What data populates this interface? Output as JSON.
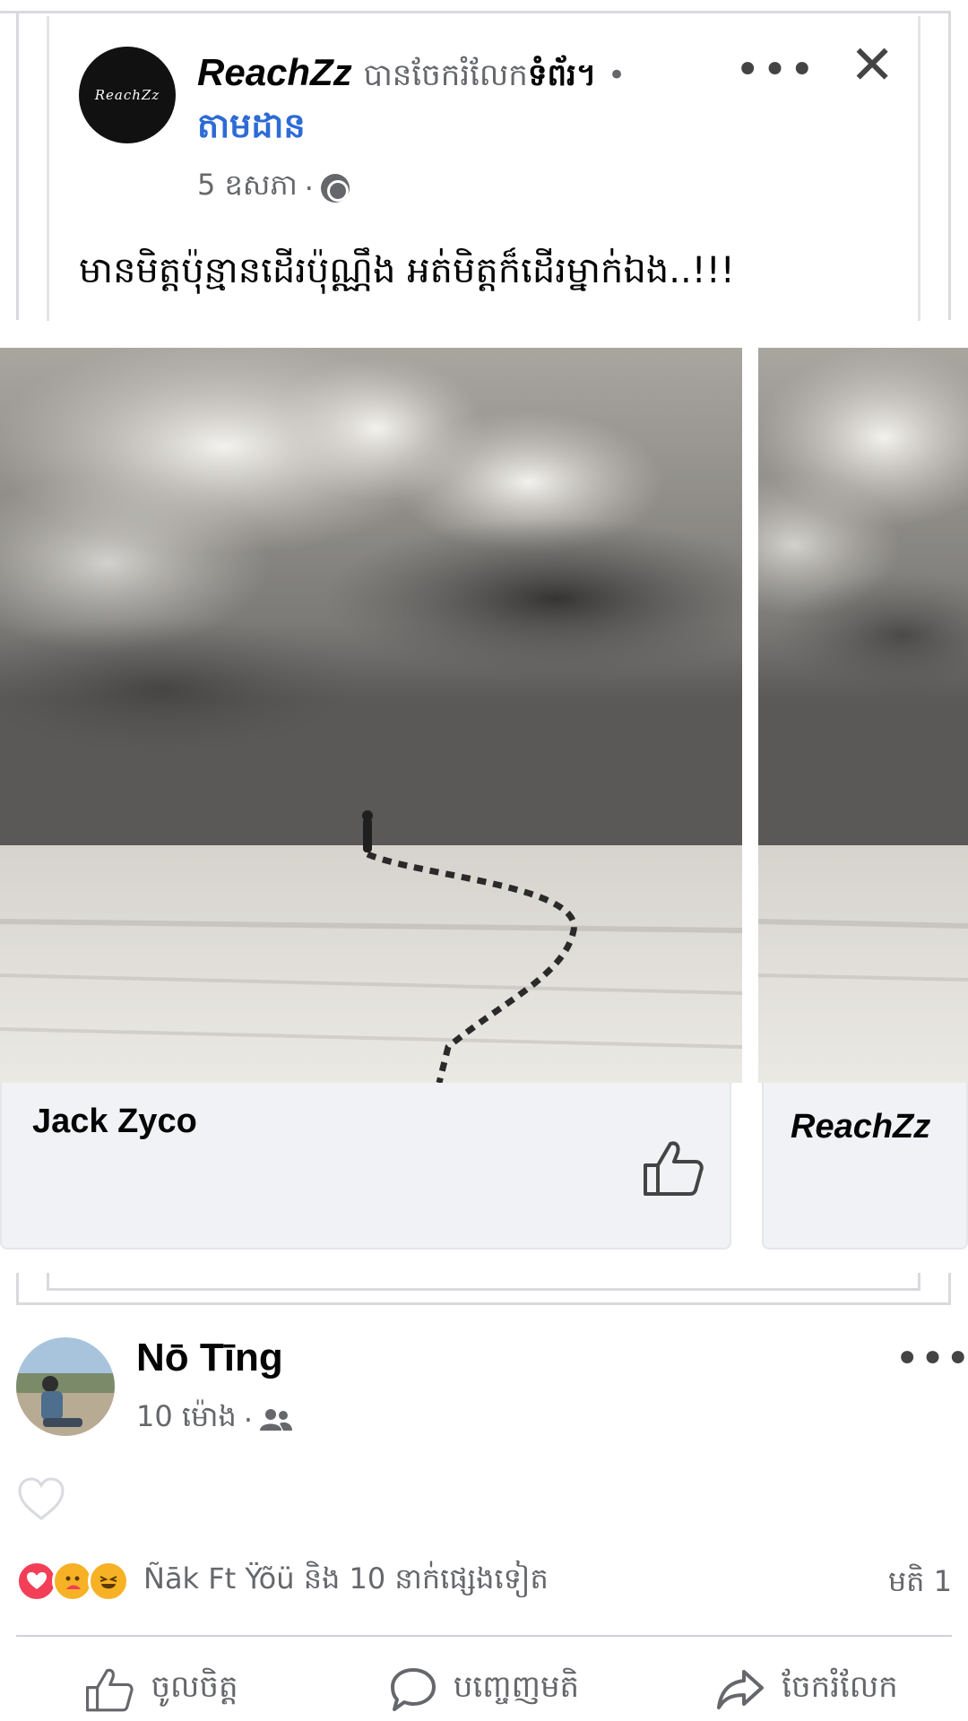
{
  "shared_post": {
    "author": "ReachZz",
    "verb": "បានចែករំលែក",
    "object": "ទំព័រ។",
    "separator": "•",
    "follow": "តាមដាន",
    "date": "5 ឧសភា",
    "separator2": "·",
    "text": "មានមិត្តប៉ុន្មានដើរប៉ុណ្ណឹង  អត់មិត្តក៏ដើរម្នាក់ឯង..!!!",
    "avatar_text": "ReachZz",
    "more_icon": "•••",
    "close_icon": "✕"
  },
  "carousel": [
    {
      "name": "Jack Zyco"
    },
    {
      "name": "ReachZz"
    }
  ],
  "post": {
    "author": "Nō Tīng",
    "time": "10 ម៉ោង",
    "separator": "·",
    "more_icon": "•••"
  },
  "reactions": {
    "text": "Ñāk Ft Ÿõü និង 10 នាក់ផ្សេងទៀត",
    "comments": "មតិ 1",
    "types": [
      "love",
      "care",
      "haha"
    ]
  },
  "actions": {
    "like": "ចូលចិត្ត",
    "comment": "បញ្ចេញមតិ",
    "share": "ចែករំលែក"
  },
  "colors": {
    "link": "#2d6bd6",
    "muted": "#65676b",
    "love": "#f33e58",
    "haha": "#f7b125"
  }
}
